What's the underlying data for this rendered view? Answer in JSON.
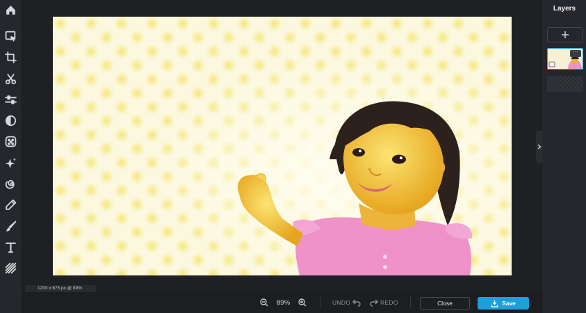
{
  "layers": {
    "title": "Layers"
  },
  "canvas": {
    "size_readout": "1200 x 675 px @ 89%"
  },
  "bottom": {
    "zoom": "89%",
    "undo": "UNDO",
    "redo": "REDO",
    "close": "Close",
    "save": "Save"
  },
  "colors": {
    "accent": "#1e9fd9",
    "panel": "#26272c",
    "background": "#1d1e22"
  },
  "tools": [
    "home-icon",
    "select-icon",
    "crop-icon",
    "cut-icon",
    "adjust-icon",
    "filter-icon",
    "effects-icon",
    "magic-icon",
    "liquify-icon",
    "brush-icon",
    "paint-icon",
    "text-icon",
    "texture-icon"
  ]
}
